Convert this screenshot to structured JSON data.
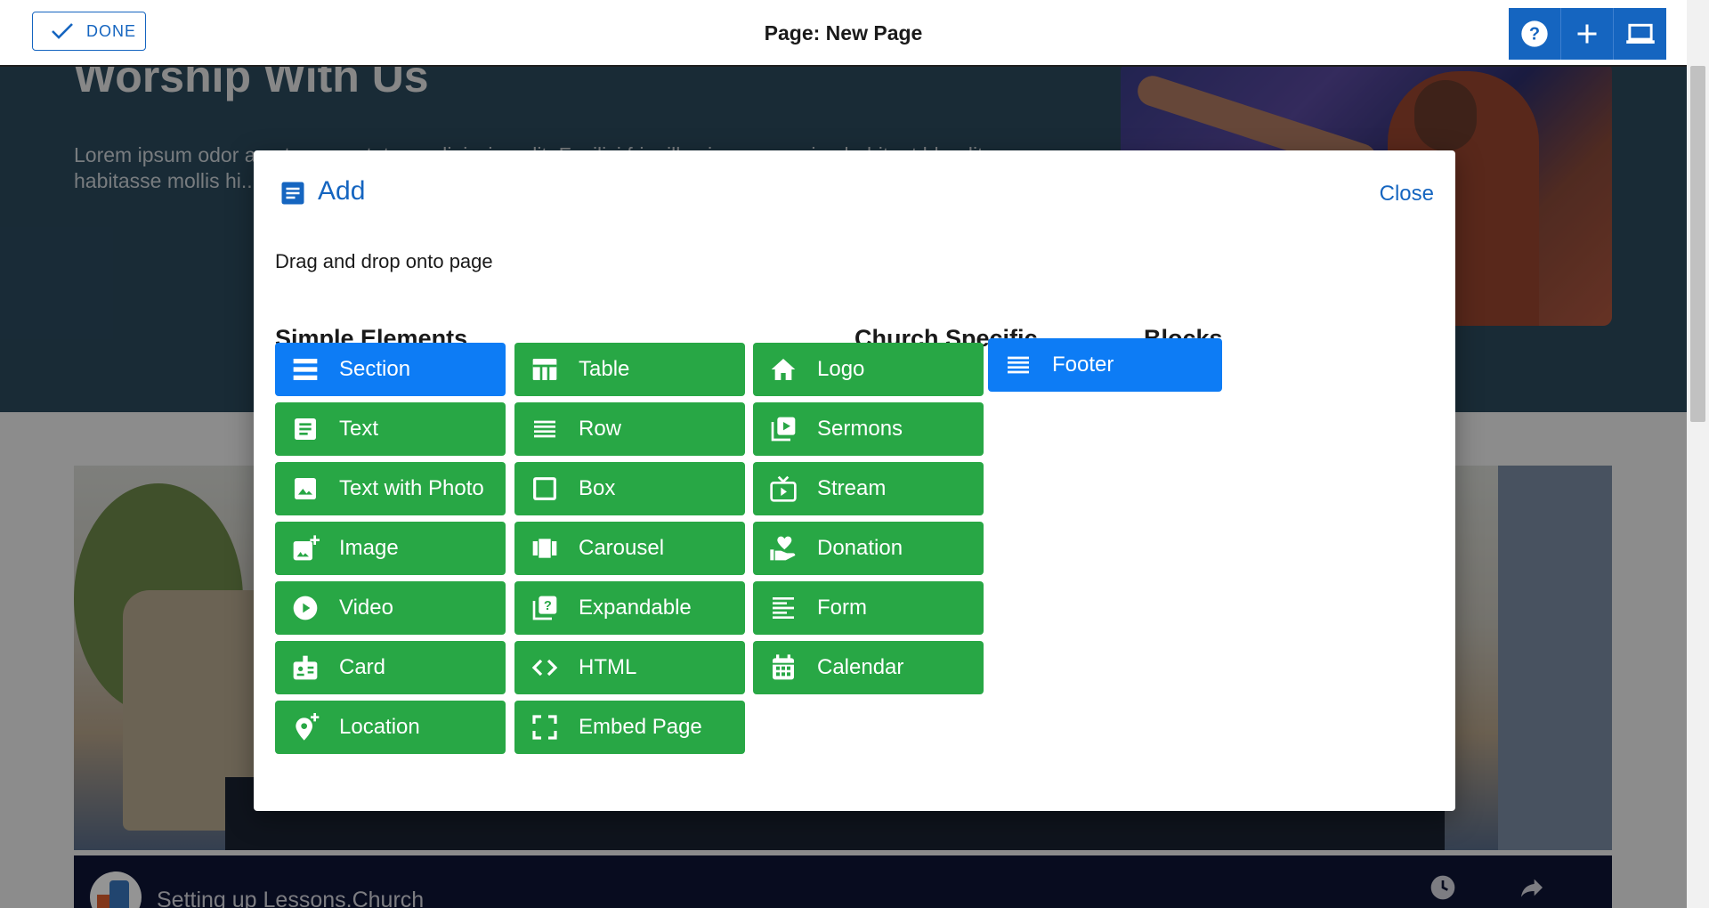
{
  "background": {
    "hero_title": "Worship With Us",
    "hero_text": "Lorem ipsum odor amet, consectetuer adipiscing elit. Facilisi fringilla vivamus sapien habitant blandit habitasse mollis hi... Malesuada laoreet... Duis dui fermentum...",
    "video_title": "Setting up Lessons.Church"
  },
  "toolbar": {
    "done_label": "DONE",
    "page_title": "Page: New Page",
    "buttons": [
      {
        "icon": "help-icon"
      },
      {
        "icon": "add-icon"
      },
      {
        "icon": "device-preview-icon"
      }
    ]
  },
  "modal": {
    "title": "Add",
    "close_label": "Close",
    "description": "Drag and drop onto page",
    "sections": {
      "simple": "Simple Elements",
      "church": "Church Specific",
      "blocks": "Blocks"
    },
    "simple_col1": [
      {
        "label": "Section",
        "icon": "section-icon",
        "color": "#0d7cf5"
      },
      {
        "label": "Text",
        "icon": "text-icon",
        "color": "#28a745"
      },
      {
        "label": "Text with Photo",
        "icon": "photo-icon",
        "color": "#28a745"
      },
      {
        "label": "Image",
        "icon": "add-photo-icon",
        "color": "#28a745"
      },
      {
        "label": "Video",
        "icon": "play-circle-icon",
        "color": "#28a745"
      },
      {
        "label": "Card",
        "icon": "badge-icon",
        "color": "#28a745"
      },
      {
        "label": "Location",
        "icon": "add-location-icon",
        "color": "#28a745"
      }
    ],
    "simple_col2": [
      {
        "label": "Table",
        "icon": "table-icon",
        "color": "#28a745"
      },
      {
        "label": "Row",
        "icon": "row-icon",
        "color": "#28a745"
      },
      {
        "label": "Box",
        "icon": "box-icon",
        "color": "#28a745"
      },
      {
        "label": "Carousel",
        "icon": "carousel-icon",
        "color": "#28a745"
      },
      {
        "label": "Expandable",
        "icon": "quiz-icon",
        "color": "#28a745"
      },
      {
        "label": "HTML",
        "icon": "code-icon",
        "color": "#28a745"
      },
      {
        "label": "Embed Page",
        "icon": "fullscreen-icon",
        "color": "#28a745"
      }
    ],
    "church": [
      {
        "label": "Logo",
        "icon": "home-icon",
        "color": "#28a745"
      },
      {
        "label": "Sermons",
        "icon": "video-library-icon",
        "color": "#28a745"
      },
      {
        "label": "Stream",
        "icon": "live-tv-icon",
        "color": "#28a745"
      },
      {
        "label": "Donation",
        "icon": "volunteer-icon",
        "color": "#28a745"
      },
      {
        "label": "Form",
        "icon": "form-icon",
        "color": "#28a745"
      },
      {
        "label": "Calendar",
        "icon": "calendar-icon",
        "color": "#28a745"
      }
    ],
    "blocks": [
      {
        "label": "Footer",
        "icon": "footer-icon",
        "color": "#0d7cf5"
      }
    ]
  }
}
